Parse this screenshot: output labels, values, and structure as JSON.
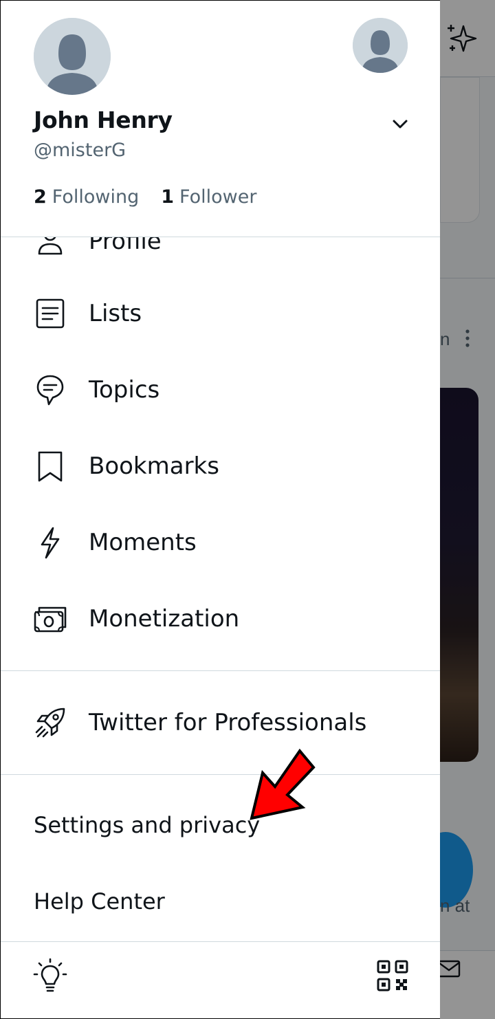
{
  "background": {
    "partial_text_right": "n",
    "partial_text_bottom": "n at",
    "icons": [
      "sparkle-icon",
      "more-vertical-icon",
      "compose-fab",
      "mail-icon"
    ]
  },
  "account": {
    "name": "John Henry",
    "handle": "@misterG",
    "following_count": "2",
    "following_label": "Following",
    "followers_count": "1",
    "followers_label": "Follower"
  },
  "menu": {
    "items": [
      {
        "label": "Profile",
        "icon": "person-icon"
      },
      {
        "label": "Lists",
        "icon": "lists-icon"
      },
      {
        "label": "Topics",
        "icon": "topics-icon"
      },
      {
        "label": "Bookmarks",
        "icon": "bookmark-icon"
      },
      {
        "label": "Moments",
        "icon": "lightning-icon"
      },
      {
        "label": "Monetization",
        "icon": "money-icon"
      }
    ],
    "professional": {
      "label": "Twitter for Professionals",
      "icon": "rocket-icon"
    },
    "settings_label": "Settings and privacy",
    "help_label": "Help Center"
  },
  "footer": {
    "left_icon": "lightbulb-icon",
    "right_icon": "qr-code-icon"
  },
  "colors": {
    "text_primary": "#0f1419",
    "text_secondary": "#536471",
    "divider": "#cfd9de",
    "avatar_bg": "#ccd6dd",
    "avatar_fg": "#66778a",
    "accent_blue": "#1d9bf0",
    "annotation_arrow": "#ff0000"
  }
}
